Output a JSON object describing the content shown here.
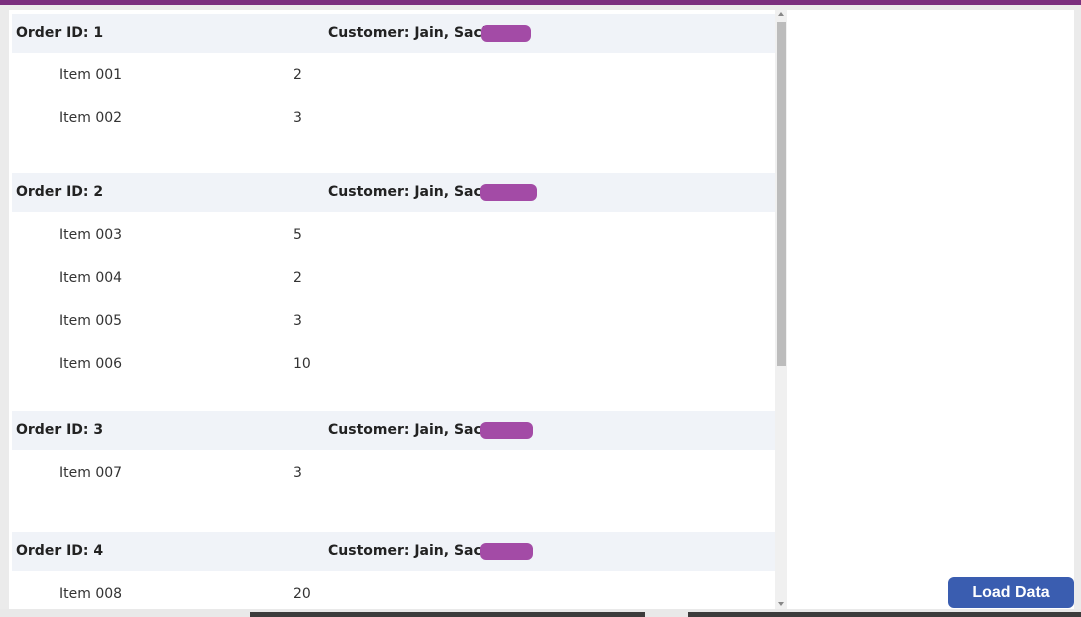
{
  "window": {
    "accent_color": "#7b2f7e"
  },
  "orders": [
    {
      "order_id_label": "Order ID: 1",
      "customer_label": "Customer: Jain, Sachin",
      "items": [
        {
          "name": "Item 001",
          "qty": "2"
        },
        {
          "name": "Item 002",
          "qty": "3"
        }
      ]
    },
    {
      "order_id_label": "Order ID: 2",
      "customer_label": "Customer: Jain, Sachin",
      "items": [
        {
          "name": "Item 003",
          "qty": "5"
        },
        {
          "name": "Item 004",
          "qty": "2"
        },
        {
          "name": "Item 005",
          "qty": "3"
        },
        {
          "name": "Item 006",
          "qty": "10"
        }
      ]
    },
    {
      "order_id_label": "Order ID: 3",
      "customer_label": "Customer: Jain, Sachin",
      "items": [
        {
          "name": "Item 007",
          "qty": "3"
        }
      ]
    },
    {
      "order_id_label": "Order ID: 4",
      "customer_label": "Customer: Jain, Sachin",
      "items": [
        {
          "name": "Item 008",
          "qty": "20"
        }
      ]
    }
  ],
  "actions": {
    "load_data_label": "Load Data"
  },
  "colors": {
    "header_row_bg": "#f0f3f8",
    "redaction": "#a34ba6",
    "button_bg": "#3a5db0"
  }
}
